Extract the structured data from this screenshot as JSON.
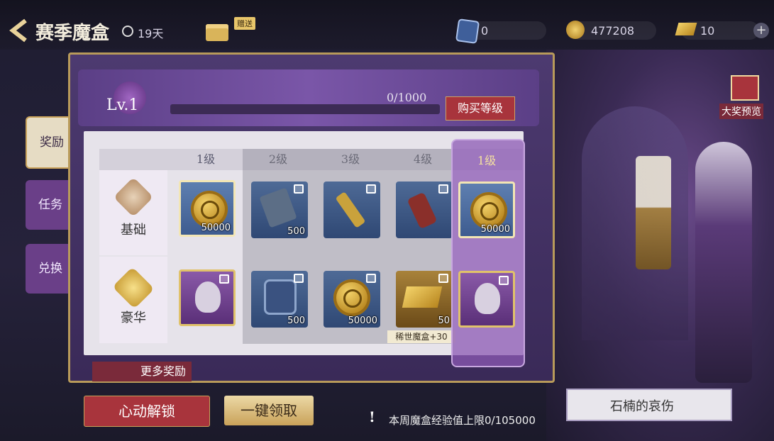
{
  "header": {
    "title": "赛季魔盒",
    "timer": "19天",
    "gift_label": "赠送",
    "currencies": [
      {
        "icon": "shard-icon",
        "value": "0"
      },
      {
        "icon": "coin-icon",
        "value": "477208"
      },
      {
        "icon": "gold-bar-icon",
        "value": "10"
      }
    ]
  },
  "level": {
    "label": "Lv.1",
    "progress_text": "0/1000",
    "progress": 0,
    "buy_label": "购买等级"
  },
  "side_tabs": [
    {
      "label": "奖励",
      "active": true
    },
    {
      "label": "任务",
      "active": false
    },
    {
      "label": "兑换",
      "active": false
    }
  ],
  "grid": {
    "columns": [
      "1级",
      "2级",
      "3级",
      "4级"
    ],
    "highlight_column": "1级",
    "rows": [
      {
        "label": "基础",
        "cells": [
          {
            "item": "coin-icon",
            "count": "50000",
            "locked": false
          },
          {
            "item": "map-fragment-icon",
            "count": "500",
            "locked": true
          },
          {
            "item": "flashlight-icon",
            "count": "",
            "locked": true
          },
          {
            "item": "spray-can-icon",
            "count": "",
            "locked": true
          }
        ],
        "highlight_cell": {
          "item": "coin-icon",
          "count": "50000",
          "locked": false
        }
      },
      {
        "label": "豪华",
        "cells": [
          {
            "item": "character-portrait-icon",
            "count": "",
            "locked": true
          },
          {
            "item": "shard-icon",
            "count": "500",
            "locked": true
          },
          {
            "item": "coin-icon",
            "count": "50000",
            "locked": true
          },
          {
            "item": "gold-bar-icon",
            "count": "50",
            "locked": true
          }
        ],
        "highlight_cell": {
          "item": "character-portrait-icon",
          "count": "",
          "locked": true
        }
      }
    ],
    "extra_tag": "稀世魔盒+30"
  },
  "buttons": {
    "more_rewards": "更多奖励",
    "unlock": "心动解锁",
    "claim_all": "一键领取"
  },
  "footer_note": "本周魔盒经验值上限0/105000",
  "preview": {
    "tag": "大奖预览",
    "character_name": "石楠的哀伤"
  },
  "colors": {
    "accent_red": "#a8343c",
    "gold": "#c9a25a",
    "purple": "#5b3f86"
  }
}
